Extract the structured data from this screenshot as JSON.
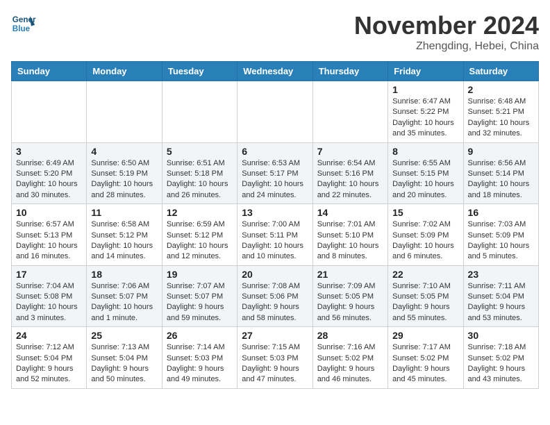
{
  "logo": {
    "line1": "General",
    "line2": "Blue"
  },
  "header": {
    "month": "November 2024",
    "location": "Zhengding, Hebei, China"
  },
  "weekdays": [
    "Sunday",
    "Monday",
    "Tuesday",
    "Wednesday",
    "Thursday",
    "Friday",
    "Saturday"
  ],
  "weeks": [
    [
      {
        "day": "",
        "info": ""
      },
      {
        "day": "",
        "info": ""
      },
      {
        "day": "",
        "info": ""
      },
      {
        "day": "",
        "info": ""
      },
      {
        "day": "",
        "info": ""
      },
      {
        "day": "1",
        "info": "Sunrise: 6:47 AM\nSunset: 5:22 PM\nDaylight: 10 hours\nand 35 minutes."
      },
      {
        "day": "2",
        "info": "Sunrise: 6:48 AM\nSunset: 5:21 PM\nDaylight: 10 hours\nand 32 minutes."
      }
    ],
    [
      {
        "day": "3",
        "info": "Sunrise: 6:49 AM\nSunset: 5:20 PM\nDaylight: 10 hours\nand 30 minutes."
      },
      {
        "day": "4",
        "info": "Sunrise: 6:50 AM\nSunset: 5:19 PM\nDaylight: 10 hours\nand 28 minutes."
      },
      {
        "day": "5",
        "info": "Sunrise: 6:51 AM\nSunset: 5:18 PM\nDaylight: 10 hours\nand 26 minutes."
      },
      {
        "day": "6",
        "info": "Sunrise: 6:53 AM\nSunset: 5:17 PM\nDaylight: 10 hours\nand 24 minutes."
      },
      {
        "day": "7",
        "info": "Sunrise: 6:54 AM\nSunset: 5:16 PM\nDaylight: 10 hours\nand 22 minutes."
      },
      {
        "day": "8",
        "info": "Sunrise: 6:55 AM\nSunset: 5:15 PM\nDaylight: 10 hours\nand 20 minutes."
      },
      {
        "day": "9",
        "info": "Sunrise: 6:56 AM\nSunset: 5:14 PM\nDaylight: 10 hours\nand 18 minutes."
      }
    ],
    [
      {
        "day": "10",
        "info": "Sunrise: 6:57 AM\nSunset: 5:13 PM\nDaylight: 10 hours\nand 16 minutes."
      },
      {
        "day": "11",
        "info": "Sunrise: 6:58 AM\nSunset: 5:12 PM\nDaylight: 10 hours\nand 14 minutes."
      },
      {
        "day": "12",
        "info": "Sunrise: 6:59 AM\nSunset: 5:12 PM\nDaylight: 10 hours\nand 12 minutes."
      },
      {
        "day": "13",
        "info": "Sunrise: 7:00 AM\nSunset: 5:11 PM\nDaylight: 10 hours\nand 10 minutes."
      },
      {
        "day": "14",
        "info": "Sunrise: 7:01 AM\nSunset: 5:10 PM\nDaylight: 10 hours\nand 8 minutes."
      },
      {
        "day": "15",
        "info": "Sunrise: 7:02 AM\nSunset: 5:09 PM\nDaylight: 10 hours\nand 6 minutes."
      },
      {
        "day": "16",
        "info": "Sunrise: 7:03 AM\nSunset: 5:09 PM\nDaylight: 10 hours\nand 5 minutes."
      }
    ],
    [
      {
        "day": "17",
        "info": "Sunrise: 7:04 AM\nSunset: 5:08 PM\nDaylight: 10 hours\nand 3 minutes."
      },
      {
        "day": "18",
        "info": "Sunrise: 7:06 AM\nSunset: 5:07 PM\nDaylight: 10 hours\nand 1 minute."
      },
      {
        "day": "19",
        "info": "Sunrise: 7:07 AM\nSunset: 5:07 PM\nDaylight: 9 hours\nand 59 minutes."
      },
      {
        "day": "20",
        "info": "Sunrise: 7:08 AM\nSunset: 5:06 PM\nDaylight: 9 hours\nand 58 minutes."
      },
      {
        "day": "21",
        "info": "Sunrise: 7:09 AM\nSunset: 5:05 PM\nDaylight: 9 hours\nand 56 minutes."
      },
      {
        "day": "22",
        "info": "Sunrise: 7:10 AM\nSunset: 5:05 PM\nDaylight: 9 hours\nand 55 minutes."
      },
      {
        "day": "23",
        "info": "Sunrise: 7:11 AM\nSunset: 5:04 PM\nDaylight: 9 hours\nand 53 minutes."
      }
    ],
    [
      {
        "day": "24",
        "info": "Sunrise: 7:12 AM\nSunset: 5:04 PM\nDaylight: 9 hours\nand 52 minutes."
      },
      {
        "day": "25",
        "info": "Sunrise: 7:13 AM\nSunset: 5:04 PM\nDaylight: 9 hours\nand 50 minutes."
      },
      {
        "day": "26",
        "info": "Sunrise: 7:14 AM\nSunset: 5:03 PM\nDaylight: 9 hours\nand 49 minutes."
      },
      {
        "day": "27",
        "info": "Sunrise: 7:15 AM\nSunset: 5:03 PM\nDaylight: 9 hours\nand 47 minutes."
      },
      {
        "day": "28",
        "info": "Sunrise: 7:16 AM\nSunset: 5:02 PM\nDaylight: 9 hours\nand 46 minutes."
      },
      {
        "day": "29",
        "info": "Sunrise: 7:17 AM\nSunset: 5:02 PM\nDaylight: 9 hours\nand 45 minutes."
      },
      {
        "day": "30",
        "info": "Sunrise: 7:18 AM\nSunset: 5:02 PM\nDaylight: 9 hours\nand 43 minutes."
      }
    ]
  ]
}
